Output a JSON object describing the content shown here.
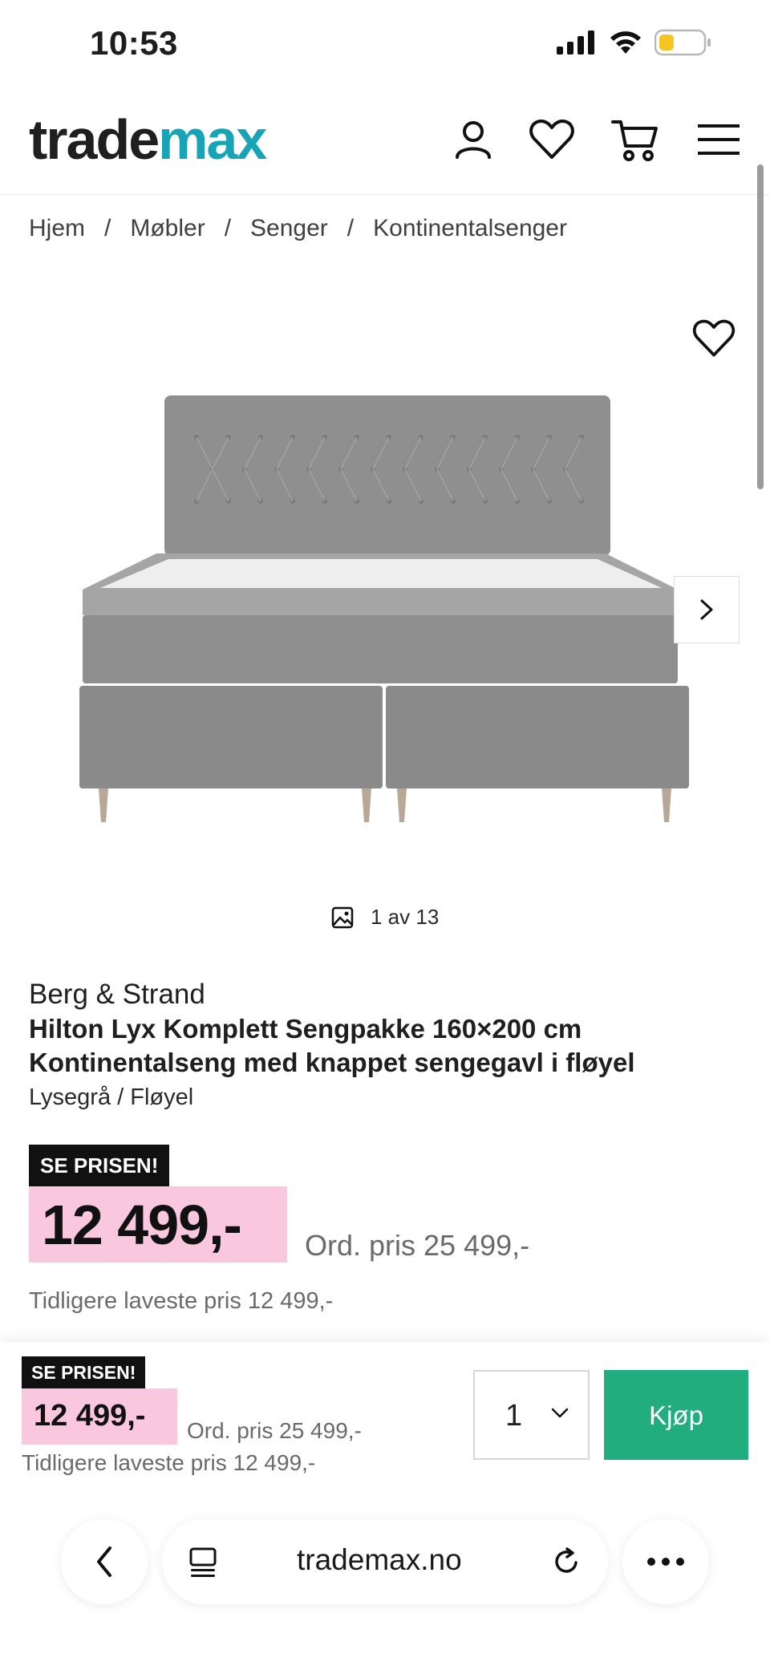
{
  "status_bar": {
    "time": "10:53"
  },
  "header": {
    "logo_part1": "trade",
    "logo_part2": "max"
  },
  "breadcrumb": [
    "Hjem",
    "Møbler",
    "Senger",
    "Kontinentalsenger"
  ],
  "breadcrumb_sep": "/",
  "gallery": {
    "counter": "1 av 13"
  },
  "product": {
    "brand": "Berg & Strand",
    "title": "Hilton Lyx Komplett Sengpakke 160×200 cm Kontinentalseng med knappet sengegavl i fløyel",
    "variant": "Lysegrå / Fløyel",
    "badge": "SE PRISEN!",
    "price": "12 499,-",
    "ord_price": "Ord. pris 25 499,-",
    "lowest_price": "Tidligere laveste pris 12 499,-"
  },
  "sticky": {
    "badge": "SE PRISEN!",
    "price": "12 499,-",
    "ord_price": "Ord. pris 25 499,-",
    "lowest_price": "Tidligere laveste pris 12 499,-",
    "quantity": "1",
    "buy_label": "Kjøp"
  },
  "browser": {
    "url": "trademax.no"
  },
  "colors": {
    "accent": "#17a4b7",
    "buy": "#21ad7d",
    "price_bg": "#f9c8df"
  }
}
